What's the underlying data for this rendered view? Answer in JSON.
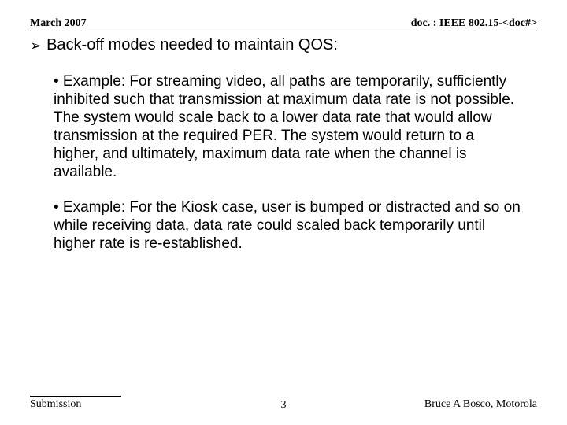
{
  "header": {
    "date": "March 2007",
    "docref": "doc. : IEEE 802.15-<doc#>"
  },
  "main": {
    "bullet_arrow_text": "Back-off modes needed to maintain QOS:",
    "example1": "• Example: For streaming video, all paths are temporarily, sufficiently inhibited such that transmission at maximum data rate is not possible. The system would scale back to a lower data rate that would allow transmission at the required PER. The system would return to a higher, and ultimately,  maximum data rate when the channel is available.",
    "example2": "• Example: For the Kiosk case,  user is bumped or distracted and so on while receiving data, data rate could scaled back temporarily until higher rate is re-established."
  },
  "footer": {
    "left": "Submission",
    "page_number": "3",
    "right": "Bruce A Bosco, Motorola"
  }
}
